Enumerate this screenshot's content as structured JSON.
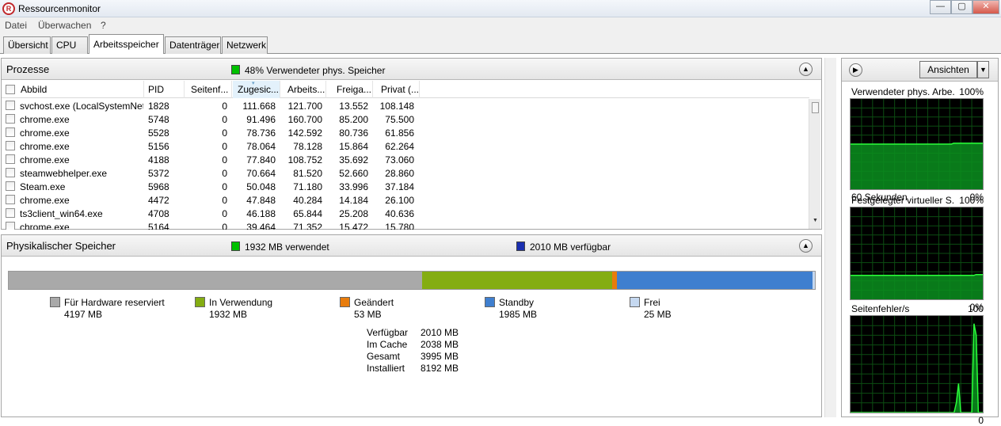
{
  "window": {
    "title": "Ressourcenmonitor",
    "icon": "resmon-icon",
    "btn_min": "—",
    "btn_max": "▢",
    "btn_close": "✕"
  },
  "menu": [
    "Datei",
    "Überwachen",
    "?"
  ],
  "tabs": [
    "Übersicht",
    "CPU",
    "Arbeitsspeicher",
    "Datenträger",
    "Netzwerk"
  ],
  "active_tab": "Arbeitsspeicher",
  "processes": {
    "title": "Prozesse",
    "summary": "48% Verwendeter phys. Speicher",
    "summary_color": "#00c000",
    "columns": [
      "Abbild",
      "PID",
      "Seitenf...",
      "Zugesic...",
      "Arbeits...",
      "Freiga...",
      "Privat (..."
    ],
    "rows": [
      [
        "svchost.exe (LocalSystemNet...",
        "1828",
        "0",
        "111.668",
        "121.700",
        "13.552",
        "108.148"
      ],
      [
        "chrome.exe",
        "5748",
        "0",
        "91.496",
        "160.700",
        "85.200",
        "75.500"
      ],
      [
        "chrome.exe",
        "5528",
        "0",
        "78.736",
        "142.592",
        "80.736",
        "61.856"
      ],
      [
        "chrome.exe",
        "5156",
        "0",
        "78.064",
        "78.128",
        "15.864",
        "62.264"
      ],
      [
        "chrome.exe",
        "4188",
        "0",
        "77.840",
        "108.752",
        "35.692",
        "73.060"
      ],
      [
        "steamwebhelper.exe",
        "5372",
        "0",
        "70.664",
        "81.520",
        "52.660",
        "28.860"
      ],
      [
        "Steam.exe",
        "5968",
        "0",
        "50.048",
        "71.180",
        "33.996",
        "37.184"
      ],
      [
        "chrome.exe",
        "4472",
        "0",
        "47.848",
        "40.284",
        "14.184",
        "26.100"
      ],
      [
        "ts3client_win64.exe",
        "4708",
        "0",
        "46.188",
        "65.844",
        "25.208",
        "40.636"
      ],
      [
        "chrome.exe",
        "5164",
        "0",
        "39.464",
        "71.352",
        "15.472",
        "15.780"
      ]
    ]
  },
  "physical": {
    "title": "Physikalischer Speicher",
    "used_label": "1932 MB verwendet",
    "available_label": "2010 MB verfügbar",
    "segments": [
      {
        "name": "Für Hardware reserviert",
        "value": "4197 MB",
        "mb": 4197,
        "color": "#a9a9a9"
      },
      {
        "name": "In Verwendung",
        "value": "1932 MB",
        "mb": 1932,
        "color": "#84ad12"
      },
      {
        "name": "Geändert",
        "value": "53 MB",
        "mb": 53,
        "color": "#e87c0c"
      },
      {
        "name": "Standby",
        "value": "1985 MB",
        "mb": 1985,
        "color": "#3f7fcf"
      },
      {
        "name": "Frei",
        "value": "25 MB",
        "mb": 25,
        "color": "#c5d8f0"
      }
    ],
    "stats": [
      {
        "label": "Verfügbar",
        "value": "2010 MB"
      },
      {
        "label": "Im Cache",
        "value": "2038 MB"
      },
      {
        "label": "Gesamt",
        "value": "3995 MB"
      },
      {
        "label": "Installiert",
        "value": "8192 MB"
      }
    ]
  },
  "right": {
    "views_button": "Ansichten",
    "graphs": [
      {
        "title": "Verwendeter phys. Arbe...",
        "max": "100%",
        "bottom_left": "60 Sekunden",
        "bottom_right": "0%",
        "series": [
          50,
          50,
          50,
          50,
          50,
          50,
          50,
          50,
          50,
          50,
          50,
          50,
          50,
          50,
          50,
          50,
          50,
          50,
          50,
          50,
          50,
          50,
          50,
          50,
          50,
          50,
          50,
          50,
          50,
          50,
          50,
          50,
          50,
          50,
          50,
          50,
          50,
          50,
          50,
          50,
          50,
          50,
          50,
          50,
          50,
          50,
          51,
          51,
          51,
          51,
          51,
          51,
          51,
          51,
          51,
          51,
          51,
          51,
          51,
          51
        ]
      },
      {
        "title": "Festgelegter virtueller S...",
        "max": "100%",
        "bottom_left": "",
        "bottom_right": "0%",
        "series": [
          26,
          26,
          26,
          26,
          26,
          26,
          26,
          26,
          26,
          26,
          26,
          26,
          26,
          26,
          26,
          26,
          26,
          26,
          26,
          26,
          26,
          26,
          26,
          26,
          26,
          26,
          26,
          26,
          26,
          26,
          26,
          26,
          26,
          26,
          26,
          26,
          26,
          26,
          26,
          26,
          26,
          26,
          26,
          26,
          26,
          26,
          26,
          26,
          26,
          26,
          26,
          26,
          26,
          26,
          26,
          26,
          27,
          27,
          27,
          27
        ]
      },
      {
        "title": "Seitenfehler/s",
        "max": "100",
        "bottom_left": "",
        "bottom_right": "0",
        "series": [
          0,
          0,
          0,
          0,
          0,
          0,
          0,
          0,
          0,
          0,
          0,
          0,
          0,
          0,
          0,
          0,
          0,
          0,
          0,
          0,
          0,
          0,
          0,
          0,
          0,
          0,
          0,
          0,
          0,
          0,
          0,
          0,
          0,
          0,
          0,
          0,
          0,
          0,
          0,
          0,
          0,
          0,
          0,
          0,
          0,
          0,
          0,
          0,
          10,
          30,
          0,
          0,
          0,
          0,
          0,
          0,
          92,
          80,
          0,
          0,
          0
        ]
      }
    ]
  }
}
